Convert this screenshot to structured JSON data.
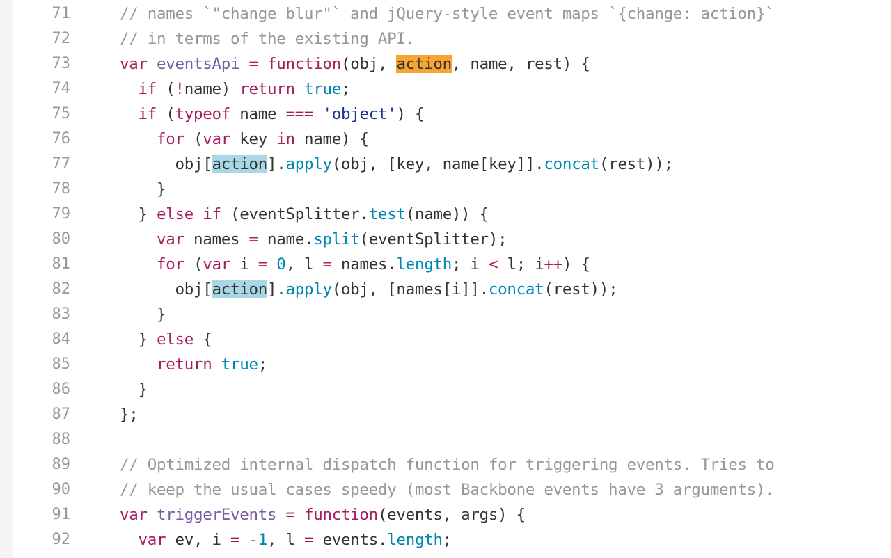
{
  "colors": {
    "comment": "#969896",
    "keyword": "#a71d5d",
    "function": "#795da3",
    "constant": "#0086b3",
    "string": "#183691",
    "plain": "#333333",
    "current_match_highlight": "#f8a631",
    "match_highlight": "#a8d7e6",
    "line_number": "#999999"
  },
  "lines": [
    {
      "n": "71",
      "tokens": [
        {
          "t": "// names `\"change blur\"` and jQuery-style event maps `{change: action}`",
          "c": "comment"
        }
      ]
    },
    {
      "n": "72",
      "tokens": [
        {
          "t": "// in terms of the existing API.",
          "c": "comment"
        }
      ]
    },
    {
      "n": "73",
      "tokens": [
        {
          "t": "var ",
          "c": "keyword"
        },
        {
          "t": "eventsApi",
          "c": "function"
        },
        {
          "t": " = ",
          "c": "keyword"
        },
        {
          "t": "function",
          "c": "keyword"
        },
        {
          "t": "(obj, ",
          "c": "plain"
        },
        {
          "t": "action",
          "c": "hl-current"
        },
        {
          "t": ", name, rest) {",
          "c": "plain"
        }
      ]
    },
    {
      "n": "74",
      "tokens": [
        {
          "t": "  ",
          "c": "plain"
        },
        {
          "t": "if",
          "c": "keyword"
        },
        {
          "t": " (",
          "c": "plain"
        },
        {
          "t": "!",
          "c": "keyword"
        },
        {
          "t": "name) ",
          "c": "plain"
        },
        {
          "t": "return",
          "c": "keyword"
        },
        {
          "t": " ",
          "c": "plain"
        },
        {
          "t": "true",
          "c": "constant"
        },
        {
          "t": ";",
          "c": "plain"
        }
      ]
    },
    {
      "n": "75",
      "tokens": [
        {
          "t": "  ",
          "c": "plain"
        },
        {
          "t": "if",
          "c": "keyword"
        },
        {
          "t": " (",
          "c": "plain"
        },
        {
          "t": "typeof",
          "c": "keyword"
        },
        {
          "t": " name ",
          "c": "plain"
        },
        {
          "t": "===",
          "c": "keyword"
        },
        {
          "t": " ",
          "c": "plain"
        },
        {
          "t": "'object'",
          "c": "string"
        },
        {
          "t": ") {",
          "c": "plain"
        }
      ]
    },
    {
      "n": "76",
      "tokens": [
        {
          "t": "    ",
          "c": "plain"
        },
        {
          "t": "for",
          "c": "keyword"
        },
        {
          "t": " (",
          "c": "plain"
        },
        {
          "t": "var",
          "c": "keyword"
        },
        {
          "t": " key ",
          "c": "plain"
        },
        {
          "t": "in",
          "c": "keyword"
        },
        {
          "t": " name) {",
          "c": "plain"
        }
      ]
    },
    {
      "n": "77",
      "tokens": [
        {
          "t": "      obj[",
          "c": "plain"
        },
        {
          "t": "action",
          "c": "hl-match"
        },
        {
          "t": "].",
          "c": "plain"
        },
        {
          "t": "apply",
          "c": "constant"
        },
        {
          "t": "(obj, [key, name[key]].",
          "c": "plain"
        },
        {
          "t": "concat",
          "c": "constant"
        },
        {
          "t": "(rest));",
          "c": "plain"
        }
      ]
    },
    {
      "n": "78",
      "tokens": [
        {
          "t": "    }",
          "c": "plain"
        }
      ]
    },
    {
      "n": "79",
      "tokens": [
        {
          "t": "  } ",
          "c": "plain"
        },
        {
          "t": "else",
          "c": "keyword"
        },
        {
          "t": " ",
          "c": "plain"
        },
        {
          "t": "if",
          "c": "keyword"
        },
        {
          "t": " (eventSplitter.",
          "c": "plain"
        },
        {
          "t": "test",
          "c": "constant"
        },
        {
          "t": "(name)) {",
          "c": "plain"
        }
      ]
    },
    {
      "n": "80",
      "tokens": [
        {
          "t": "    ",
          "c": "plain"
        },
        {
          "t": "var",
          "c": "keyword"
        },
        {
          "t": " names ",
          "c": "plain"
        },
        {
          "t": "=",
          "c": "keyword"
        },
        {
          "t": " name.",
          "c": "plain"
        },
        {
          "t": "split",
          "c": "constant"
        },
        {
          "t": "(eventSplitter);",
          "c": "plain"
        }
      ]
    },
    {
      "n": "81",
      "tokens": [
        {
          "t": "    ",
          "c": "plain"
        },
        {
          "t": "for",
          "c": "keyword"
        },
        {
          "t": " (",
          "c": "plain"
        },
        {
          "t": "var",
          "c": "keyword"
        },
        {
          "t": " i ",
          "c": "plain"
        },
        {
          "t": "=",
          "c": "keyword"
        },
        {
          "t": " ",
          "c": "plain"
        },
        {
          "t": "0",
          "c": "constant"
        },
        {
          "t": ", l ",
          "c": "plain"
        },
        {
          "t": "=",
          "c": "keyword"
        },
        {
          "t": " names.",
          "c": "plain"
        },
        {
          "t": "length",
          "c": "constant"
        },
        {
          "t": "; i ",
          "c": "plain"
        },
        {
          "t": "<",
          "c": "keyword"
        },
        {
          "t": " l; i",
          "c": "plain"
        },
        {
          "t": "++",
          "c": "keyword"
        },
        {
          "t": ") {",
          "c": "plain"
        }
      ]
    },
    {
      "n": "82",
      "tokens": [
        {
          "t": "      obj[",
          "c": "plain"
        },
        {
          "t": "action",
          "c": "hl-match"
        },
        {
          "t": "].",
          "c": "plain"
        },
        {
          "t": "apply",
          "c": "constant"
        },
        {
          "t": "(obj, [names[i]].",
          "c": "plain"
        },
        {
          "t": "concat",
          "c": "constant"
        },
        {
          "t": "(rest));",
          "c": "plain"
        }
      ]
    },
    {
      "n": "83",
      "tokens": [
        {
          "t": "    }",
          "c": "plain"
        }
      ]
    },
    {
      "n": "84",
      "tokens": [
        {
          "t": "  } ",
          "c": "plain"
        },
        {
          "t": "else",
          "c": "keyword"
        },
        {
          "t": " {",
          "c": "plain"
        }
      ]
    },
    {
      "n": "85",
      "tokens": [
        {
          "t": "    ",
          "c": "plain"
        },
        {
          "t": "return",
          "c": "keyword"
        },
        {
          "t": " ",
          "c": "plain"
        },
        {
          "t": "true",
          "c": "constant"
        },
        {
          "t": ";",
          "c": "plain"
        }
      ]
    },
    {
      "n": "86",
      "tokens": [
        {
          "t": "  }",
          "c": "plain"
        }
      ]
    },
    {
      "n": "87",
      "tokens": [
        {
          "t": "};",
          "c": "plain"
        }
      ]
    },
    {
      "n": "88",
      "tokens": []
    },
    {
      "n": "89",
      "tokens": [
        {
          "t": "// Optimized internal dispatch function for triggering events. Tries to",
          "c": "comment"
        }
      ]
    },
    {
      "n": "90",
      "tokens": [
        {
          "t": "// keep the usual cases speedy (most Backbone events have 3 arguments).",
          "c": "comment"
        }
      ]
    },
    {
      "n": "91",
      "tokens": [
        {
          "t": "var ",
          "c": "keyword"
        },
        {
          "t": "triggerEvents",
          "c": "function"
        },
        {
          "t": " = ",
          "c": "keyword"
        },
        {
          "t": "function",
          "c": "keyword"
        },
        {
          "t": "(events, args) {",
          "c": "plain"
        }
      ]
    },
    {
      "n": "92",
      "tokens": [
        {
          "t": "  ",
          "c": "plain"
        },
        {
          "t": "var",
          "c": "keyword"
        },
        {
          "t": " ev, i ",
          "c": "plain"
        },
        {
          "t": "=",
          "c": "keyword"
        },
        {
          "t": " ",
          "c": "plain"
        },
        {
          "t": "-1",
          "c": "constant"
        },
        {
          "t": ", l ",
          "c": "plain"
        },
        {
          "t": "=",
          "c": "keyword"
        },
        {
          "t": " events.",
          "c": "plain"
        },
        {
          "t": "length",
          "c": "constant"
        },
        {
          "t": ";",
          "c": "plain"
        }
      ]
    }
  ]
}
